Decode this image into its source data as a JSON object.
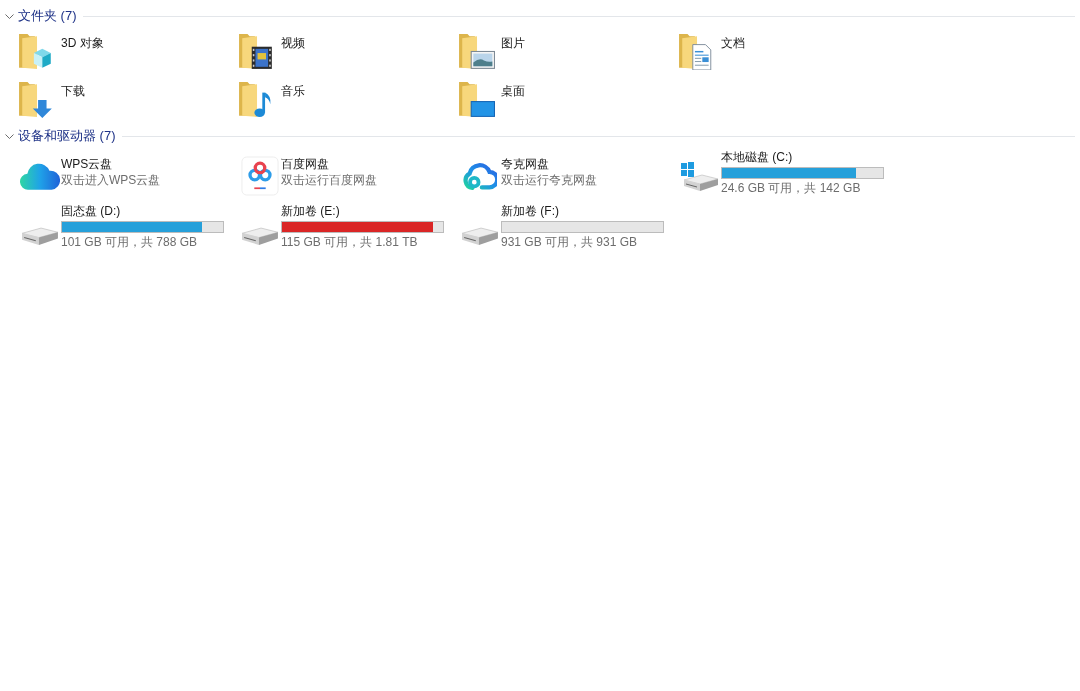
{
  "folders": {
    "title": "文件夹 (7)",
    "expanded": true,
    "items": [
      {
        "name": "3D 对象"
      },
      {
        "name": "视频"
      },
      {
        "name": "图片"
      },
      {
        "name": "文档"
      },
      {
        "name": "下载"
      },
      {
        "name": "音乐"
      },
      {
        "name": "桌面"
      }
    ]
  },
  "devices": {
    "title": "设备和驱动器 (7)",
    "expanded": true,
    "items": [
      {
        "kind": "app",
        "name": "WPS云盘",
        "subtitle": "双击进入WPS云盘"
      },
      {
        "kind": "app",
        "name": "百度网盘",
        "subtitle": "双击运行百度网盘"
      },
      {
        "kind": "app",
        "name": "夸克网盘",
        "subtitle": "双击运行夸克网盘"
      },
      {
        "kind": "drive",
        "name": "本地磁盘 (C:)",
        "level": 0.83,
        "color": "#26a0da",
        "space": "24.6 GB 可用，共 142 GB"
      },
      {
        "kind": "drive",
        "name": "固态盘 (D:)",
        "level": 0.87,
        "color": "#26a0da",
        "space": "101 GB 可用，共 788 GB"
      },
      {
        "kind": "drive",
        "name": "新加卷 (E:)",
        "level": 0.94,
        "color": "#da2626",
        "space": "115 GB 可用，共 1.81 TB"
      },
      {
        "kind": "drive",
        "name": "新加卷 (F:)",
        "space": "931 GB 可用，共 931 GB"
      }
    ]
  }
}
